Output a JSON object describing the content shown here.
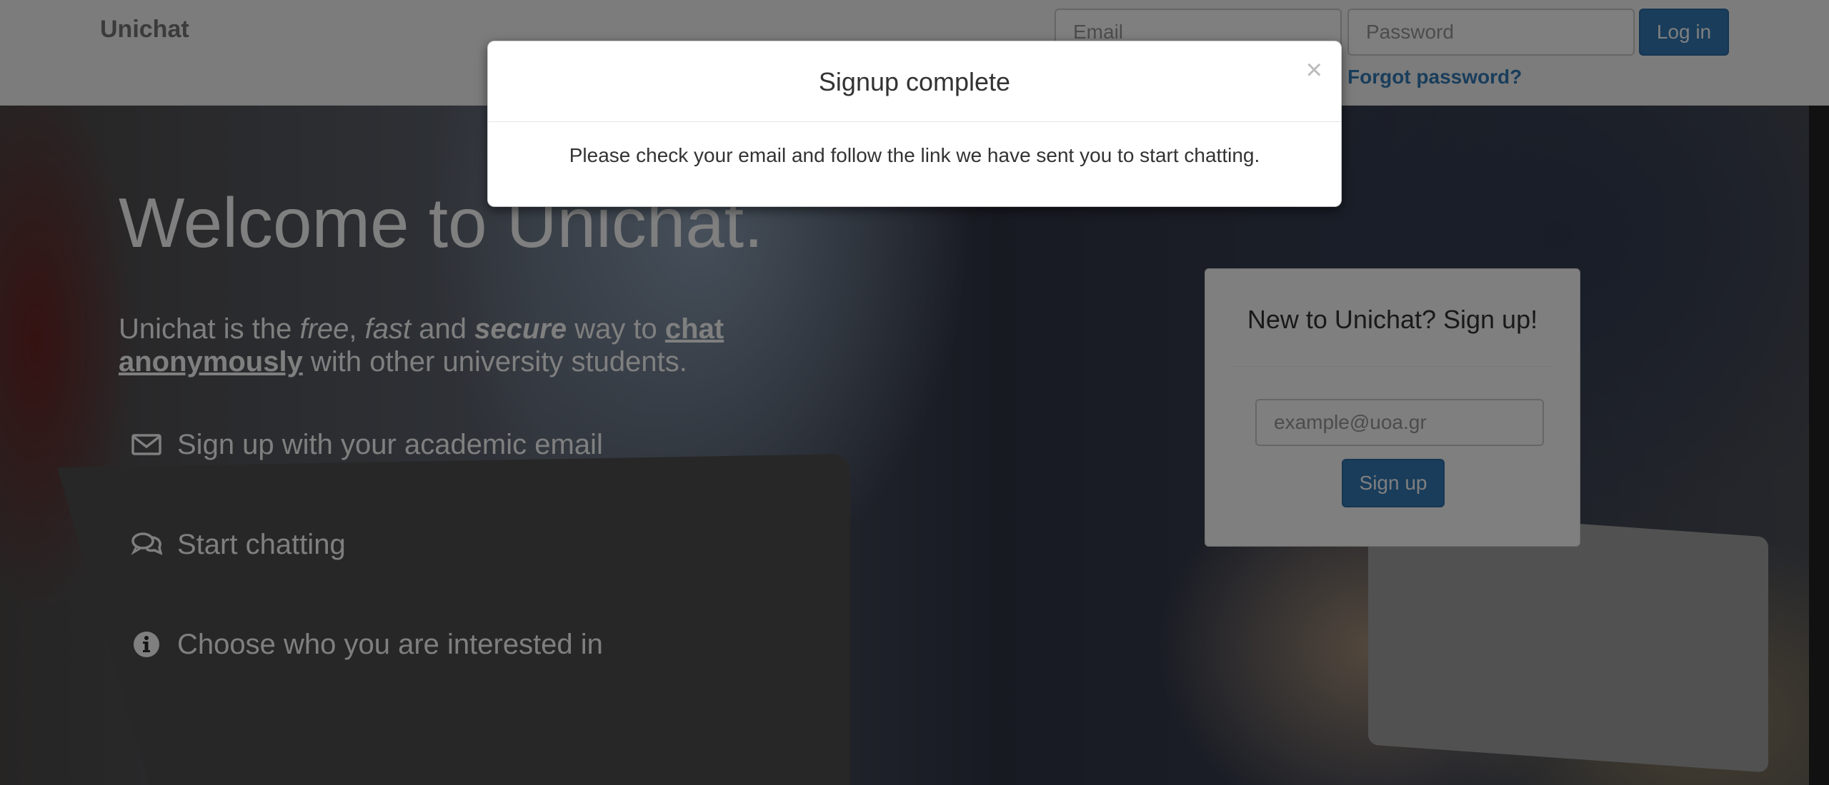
{
  "navbar": {
    "brand": "Unichat",
    "email_placeholder": "Email",
    "password_placeholder": "Password",
    "login_label": "Log in",
    "forgot_label": "Forgot password?"
  },
  "hero": {
    "welcome": "Welcome to Unichat.",
    "tagline": {
      "part1": "Unichat is the ",
      "free": "free",
      "comma": ", ",
      "fast": "fast",
      "and": " and ",
      "secure": "secure",
      "way": " way to ",
      "link": "chat anonymously",
      "rest": " with other university students."
    },
    "features": [
      {
        "icon": "envelope-icon",
        "label": "Sign up with your academic email"
      },
      {
        "icon": "comments-icon",
        "label": "Start chatting"
      },
      {
        "icon": "info-icon",
        "label": "Choose who you are interested in"
      }
    ]
  },
  "signup": {
    "title": "New to Unichat? Sign up!",
    "email_placeholder": "example@uoa.gr",
    "button_label": "Sign up"
  },
  "modal": {
    "title": "Signup complete",
    "close": "×",
    "body": "Please check your email and follow the link we have sent you to start chatting."
  }
}
